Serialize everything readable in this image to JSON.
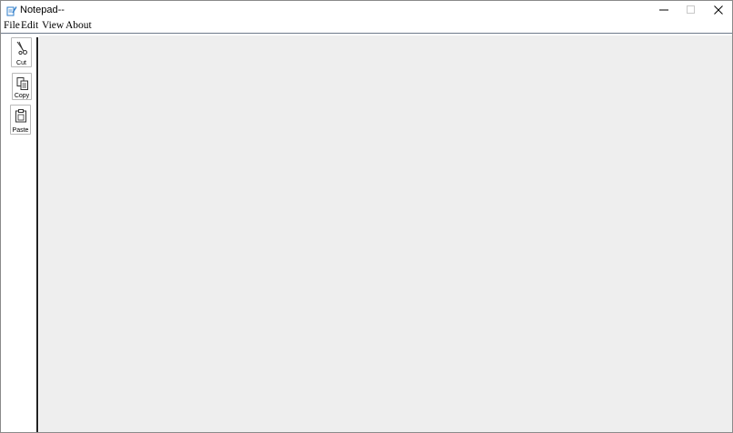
{
  "window": {
    "title": "Notepad--",
    "app_icon": "notepad-app-icon",
    "controls": [
      "minimize-icon",
      "maximize-icon",
      "close-icon"
    ]
  },
  "menu": {
    "items": [
      {
        "label": "File"
      },
      {
        "label": "Edit"
      },
      {
        "label": "View"
      },
      {
        "label": "About"
      }
    ]
  },
  "toolbar": {
    "buttons": [
      {
        "label": "Cut",
        "icon": "scissors-icon"
      },
      {
        "label": "Copy",
        "icon": "copy-icon"
      },
      {
        "label": "Paste",
        "icon": "clipboard-icon"
      }
    ]
  },
  "editor": {
    "content": "",
    "background": "#eeeeee"
  }
}
